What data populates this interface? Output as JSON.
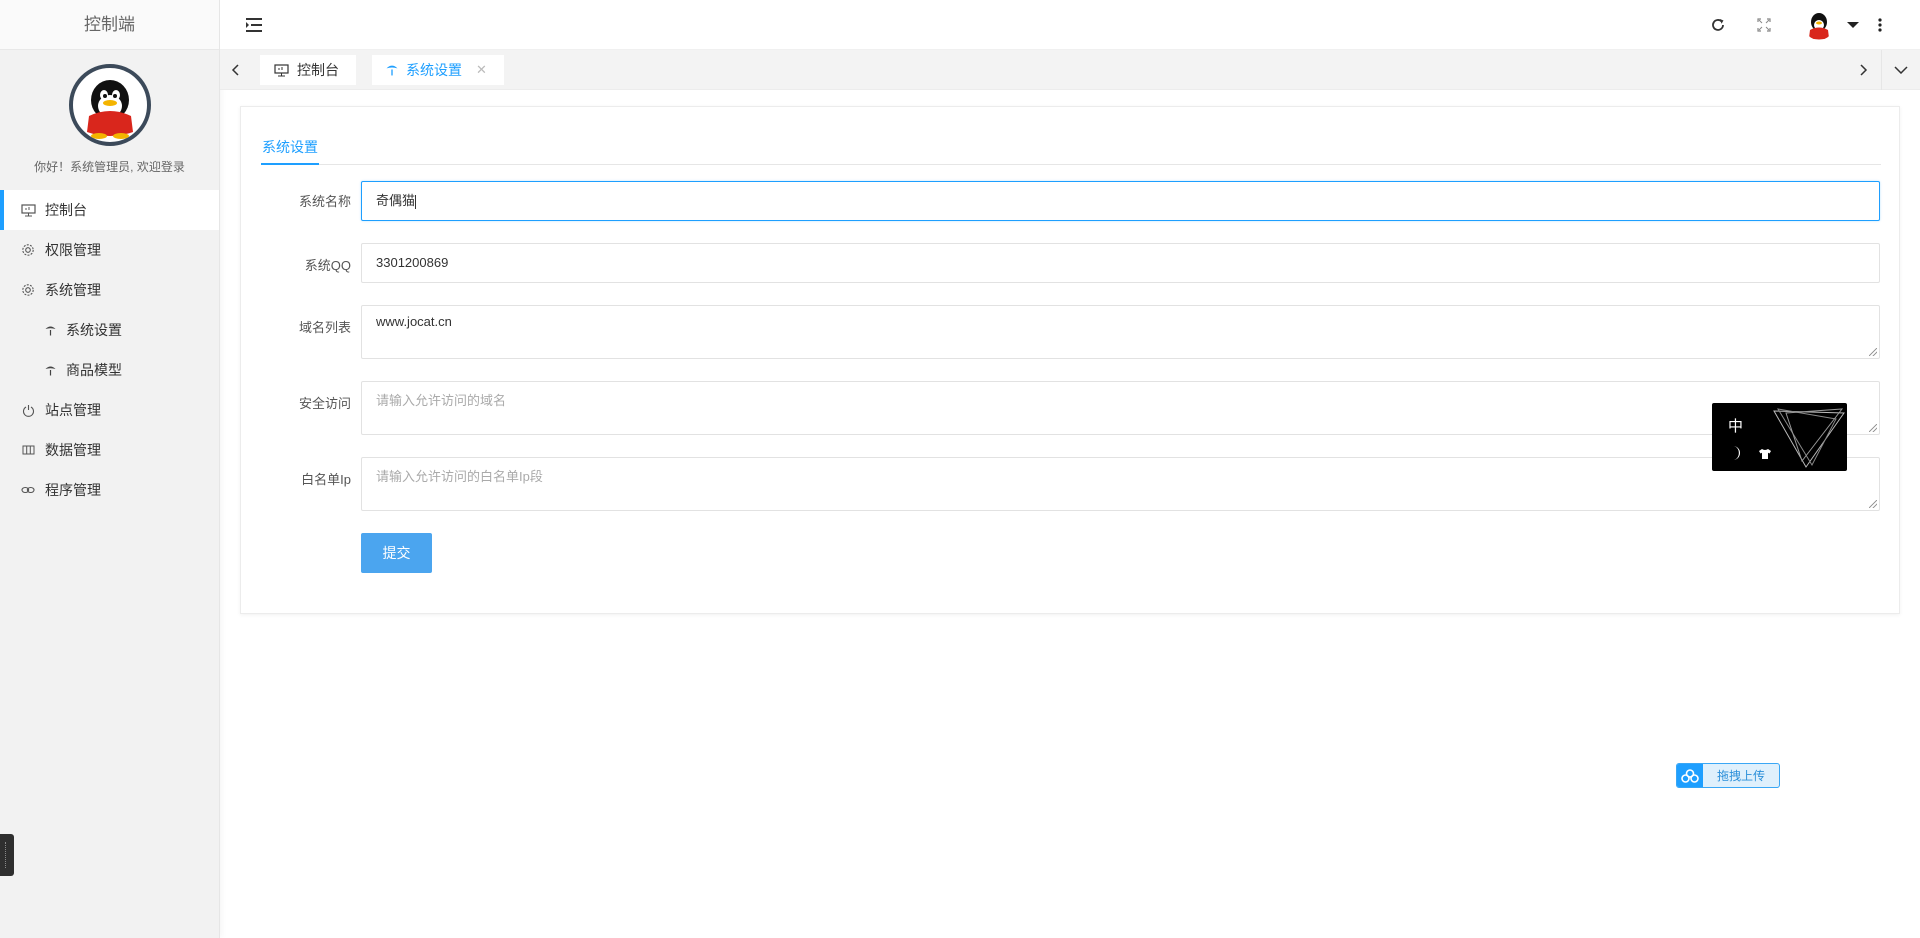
{
  "sidebar": {
    "brand": "控制端",
    "welcome": "你好！系统管理员, 欢迎登录",
    "items": [
      {
        "label": "控制台",
        "icon": "monitor-icon"
      },
      {
        "label": "权限管理",
        "icon": "gear-icon"
      },
      {
        "label": "系统管理",
        "icon": "gear-icon"
      },
      {
        "label": "系统设置",
        "icon": "palm-icon"
      },
      {
        "label": "商品模型",
        "icon": "palm-icon"
      },
      {
        "label": "站点管理",
        "icon": "power-icon"
      },
      {
        "label": "数据管理",
        "icon": "columns-icon"
      },
      {
        "label": "程序管理",
        "icon": "link-icon"
      }
    ]
  },
  "tabs": {
    "items": [
      {
        "label": "控制台",
        "icon": "monitor-icon"
      },
      {
        "label": "系统设置",
        "icon": "palm-icon"
      }
    ]
  },
  "card": {
    "tab": "系统设置"
  },
  "form": {
    "name_label": "系统名称",
    "name_value": "奇偶猫",
    "qq_label": "系统QQ",
    "qq_value": "3301200869",
    "domains_label": "域名列表",
    "domains_value": "www.jocat.cn",
    "secure_label": "安全访问",
    "secure_placeholder": "请输入允许访问的域名",
    "whitelist_label": "白名单Ip",
    "whitelist_placeholder": "请输入允许访问的白名单Ip段",
    "submit_label": "提交"
  },
  "widget": {
    "lang": "中"
  },
  "upload": {
    "label": "拖拽上传"
  },
  "colors": {
    "accent": "#1e9fff",
    "button": "#4ba5ef"
  }
}
